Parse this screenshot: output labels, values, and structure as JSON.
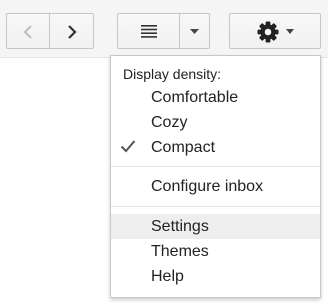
{
  "toolbar": {
    "prev_icon": "chevron-left-icon",
    "next_icon": "chevron-right-icon",
    "density_icon": "density-lines-icon",
    "caret_icon": "caret-down-icon",
    "settings_icon": "gear-icon"
  },
  "menu": {
    "density_heading": "Display density:",
    "density_options": [
      {
        "label": "Comfortable",
        "selected": false
      },
      {
        "label": "Cozy",
        "selected": false
      },
      {
        "label": "Compact",
        "selected": true
      }
    ],
    "configure_inbox": "Configure inbox",
    "items": [
      {
        "label": "Settings",
        "highlighted": true
      },
      {
        "label": "Themes",
        "highlighted": false
      },
      {
        "label": "Help",
        "highlighted": false
      }
    ]
  },
  "colors": {
    "toolbar_bg": "#f5f5f5",
    "button_border": "#c6c6c6",
    "disabled_icon": "#c0c0c0",
    "icon": "#333333",
    "hover_bg": "#eeeeee"
  }
}
